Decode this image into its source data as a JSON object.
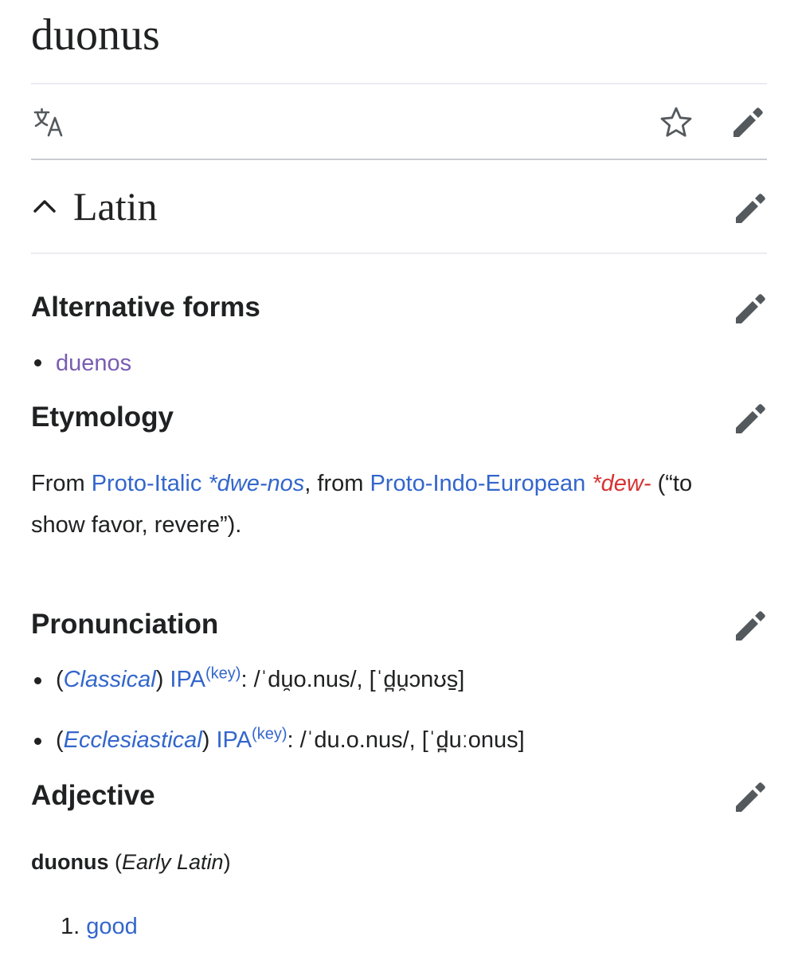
{
  "page": {
    "title": "duonus",
    "language_icon": "translate-icon",
    "watch_icon": "star-icon",
    "edit_icon": "pencil-icon"
  },
  "section": {
    "heading": "Latin",
    "collapse_icon": "chevron-up-icon"
  },
  "alternative_forms": {
    "heading": "Alternative forms",
    "items": [
      "duenos"
    ]
  },
  "etymology": {
    "heading": "Etymology",
    "t_from": "From ",
    "link_proto_italic": "Proto-Italic",
    "t_space1": " ",
    "form_italic": "*dwe-nos",
    "t_from2": ", from ",
    "link_pie": "Proto-Indo-European",
    "t_space2": " ",
    "form_pie": "*dew-",
    "t_gloss_line1": " (“to",
    "t_gloss_line2": "show favor, revere”)."
  },
  "pronunciation": {
    "heading": "Pronunciation",
    "items": [
      {
        "open": "(",
        "variety": "Classical",
        "close": ") ",
        "ipa": "IPA",
        "key": "(key)",
        "text": ": /ˈdu̯o.nus/, [ˈd̪u̯ɔnʊs̠]"
      },
      {
        "open": "(",
        "variety": "Ecclesiastical",
        "close": ") ",
        "ipa": "IPA",
        "key": "(key)",
        "text": ": /ˈdu.o.nus/, [ˈd̪uːonus]"
      }
    ]
  },
  "adjective": {
    "heading": "Adjective",
    "headword": "duonus",
    "label_open": " (",
    "label": "Early Latin",
    "label_close": ")",
    "senses": [
      {
        "num": "1.",
        "gloss": "good"
      }
    ]
  },
  "colors": {
    "link": "#3366cc",
    "visited": "#795cb2",
    "new_link": "#d73333",
    "icon": "#54595d"
  }
}
